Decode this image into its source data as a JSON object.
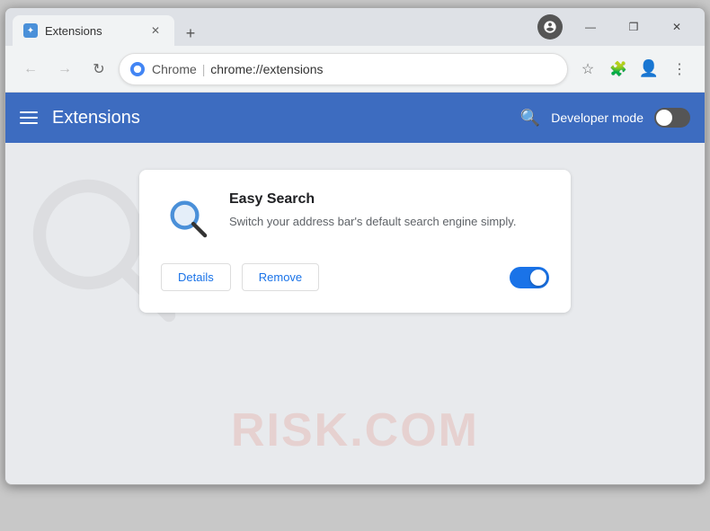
{
  "window": {
    "title": "Extensions",
    "close_label": "✕",
    "minimize_label": "—",
    "maximize_label": "❒"
  },
  "tab": {
    "title": "Extensions",
    "favicon_label": "✦"
  },
  "nav": {
    "back_label": "←",
    "forward_label": "→",
    "refresh_label": "↻",
    "brand": "Chrome",
    "url": "chrome://extensions",
    "separator": "|"
  },
  "header": {
    "title": "Extensions",
    "developer_mode_label": "Developer mode",
    "search_placeholder": "Search extensions"
  },
  "extension": {
    "name": "Easy Search",
    "description": "Switch your address bar's default search engine simply.",
    "details_label": "Details",
    "remove_label": "Remove",
    "enabled": true
  },
  "watermark": {
    "text": "RISK.COM"
  },
  "colors": {
    "header_blue": "#3d6cc0",
    "toggle_on": "#1a73e8",
    "toggle_off": "#5f5f5f",
    "button_text": "#1a73e8"
  }
}
